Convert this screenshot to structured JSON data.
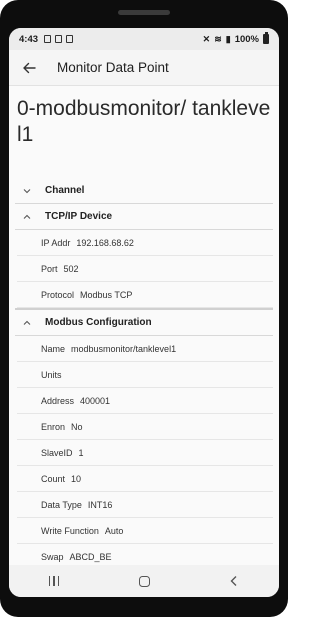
{
  "status_bar": {
    "time": "4:43",
    "battery": "100%"
  },
  "app_bar": {
    "title": "Monitor Data Point"
  },
  "point": {
    "title": "0-modbusmonitor/ tanklevel1"
  },
  "sections": {
    "channel": {
      "label": "Channel",
      "expanded": false
    },
    "tcp": {
      "label": "TCP/IP Device",
      "expanded": true,
      "rows": [
        {
          "key": "IP Addr",
          "value": "192.168.68.62"
        },
        {
          "key": "Port",
          "value": "502"
        },
        {
          "key": "Protocol",
          "value": "Modbus TCP"
        }
      ]
    },
    "modbus": {
      "label": "Modbus Configuration",
      "expanded": true,
      "rows": [
        {
          "key": "Name",
          "value": "modbusmonitor/tanklevel1"
        },
        {
          "key": "Units",
          "value": ""
        },
        {
          "key": "Address",
          "value": "400001"
        },
        {
          "key": "Enron",
          "value": "No"
        },
        {
          "key": "SlaveID",
          "value": "1"
        },
        {
          "key": "Count",
          "value": "10"
        },
        {
          "key": "Data Type",
          "value": "INT16"
        },
        {
          "key": "Write Function",
          "value": "Auto"
        },
        {
          "key": "Swap",
          "value": "ABCD_BE"
        }
      ]
    }
  },
  "icons": {
    "back": "arrow-left-icon",
    "collapse": "chevron-up-icon",
    "expand": "chevron-down-icon"
  },
  "colors": {
    "background": "#fafafa",
    "app_bar": "#f5f5f5",
    "divider": "#d8d8d8"
  }
}
